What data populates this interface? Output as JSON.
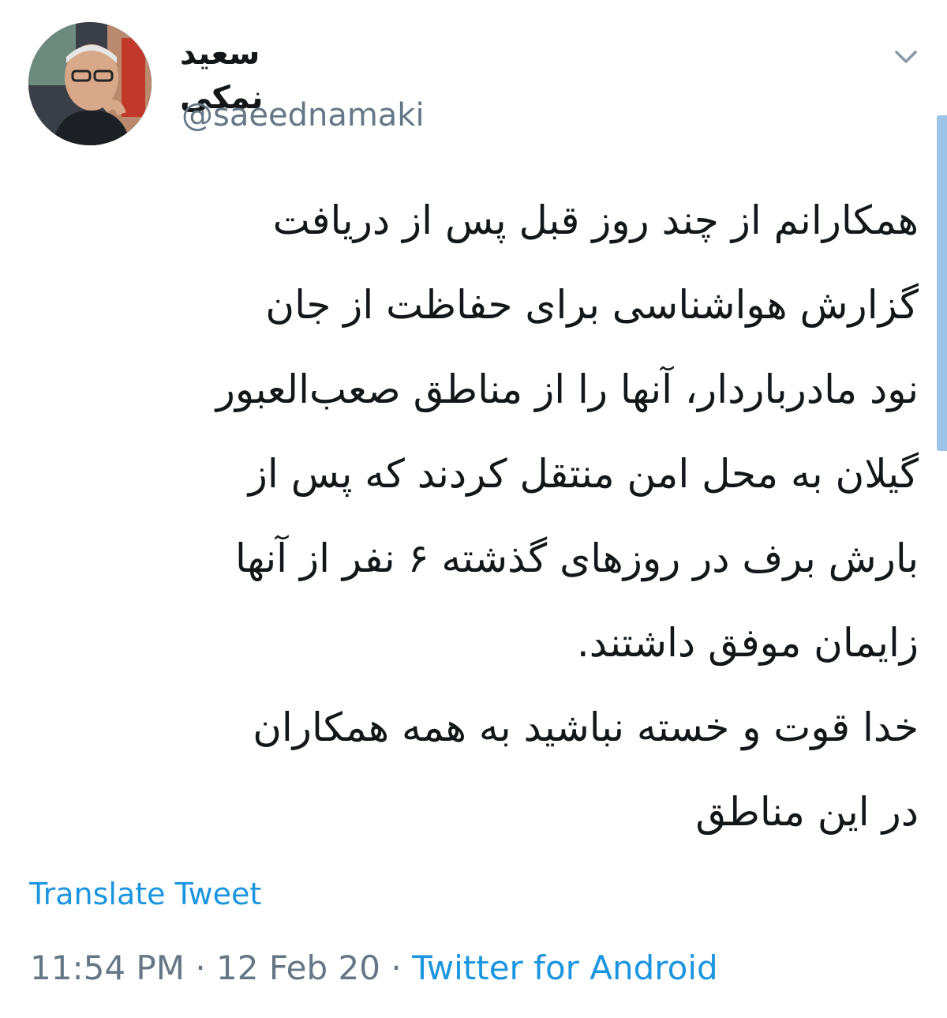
{
  "tweet": {
    "author": {
      "display_name": "سعید نمکی",
      "handle": "@saeednamaki"
    },
    "body_lines": [
      "همکارانم از چند روز قبل پس از دریافت",
      "گزارش هواشناسی برای حفاظت از جان",
      "نود مادرباردار، آنها را از مناطق صعب‌العبور",
      "گیلان به محل امن منتقل کردند که پس از",
      "بارش برف در روزهای گذشته ۶ نفر از آنها",
      "زایمان موفق داشتند.",
      "خدا قوت و خسته نباشید به همه همکاران",
      "در این مناطق"
    ],
    "translate_label": "Translate Tweet",
    "time": "11:54 PM",
    "separator": "·",
    "date": "12 Feb 20",
    "source": "Twitter for Android"
  },
  "icons": {
    "menu": "chevron-down-icon",
    "avatar": "avatar"
  },
  "colors": {
    "link": "#1b95e0",
    "secondary_text": "#657786",
    "primary_text": "#14171a"
  }
}
